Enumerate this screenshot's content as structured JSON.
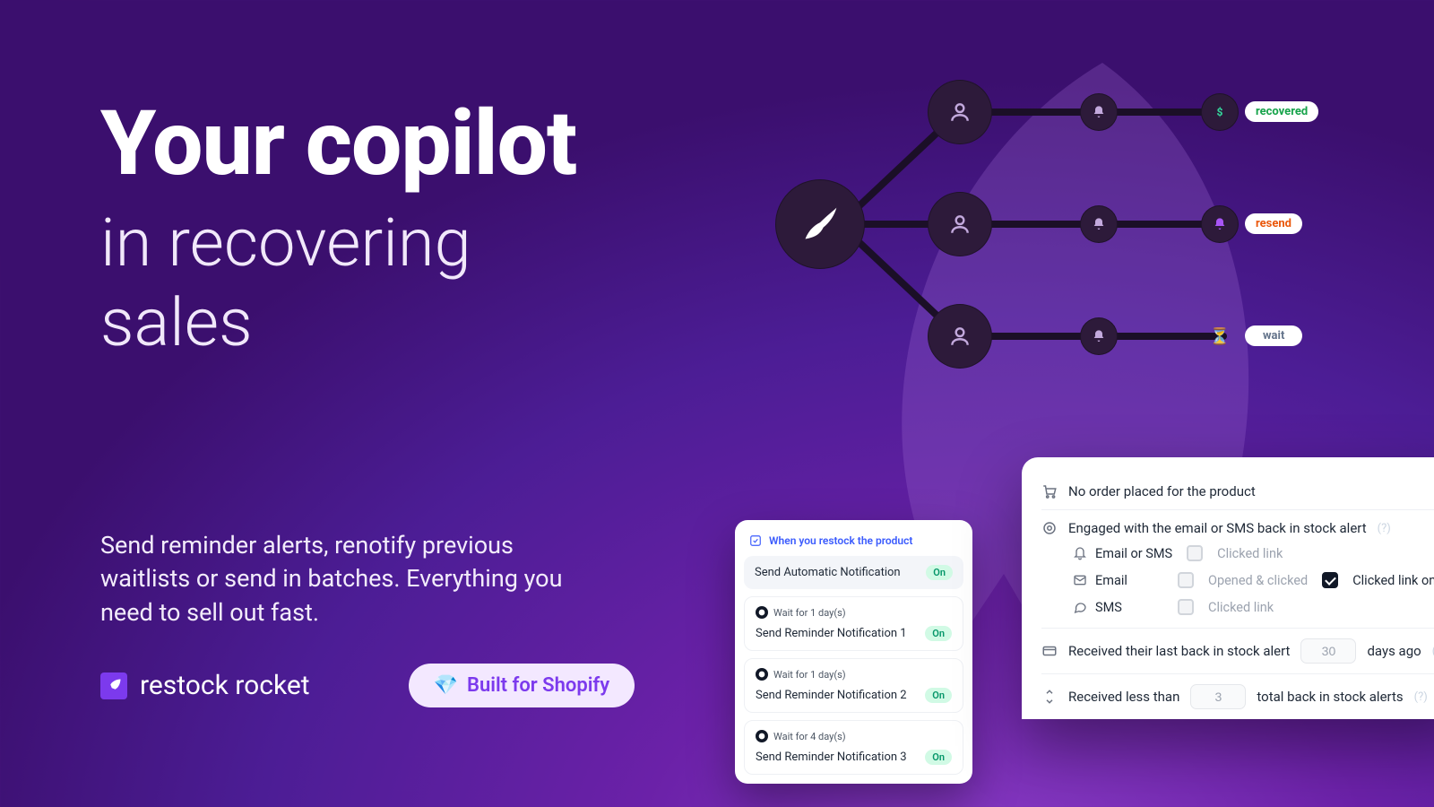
{
  "hero": {
    "headline_bold": "Your copilot",
    "headline_light": "in recovering sales",
    "subhead": "Send reminder alerts, renotify previous waitlists or send in batches. Everything you need to sell out fast.",
    "brand": "restock rocket",
    "built_badge": "Built for Shopify"
  },
  "diagram": {
    "pills": {
      "recovered": "recovered",
      "resend": "resend",
      "wait": "wait"
    }
  },
  "panel1": {
    "header": "When you restock the product",
    "auto_row": "Send Automatic Notification",
    "on": "On",
    "steps": [
      {
        "wait": "Wait for 1 day(s)",
        "label": "Send Reminder Notification 1"
      },
      {
        "wait": "Wait for 1 day(s)",
        "label": "Send Reminder Notification 2"
      },
      {
        "wait": "Wait for 4 day(s)",
        "label": "Send Reminder Notification 3"
      }
    ]
  },
  "panel2": {
    "row1": "No order placed for the product",
    "row2": "Engaged with the email or SMS back in stock alert",
    "channels": {
      "both": "Email or SMS",
      "both_opt": "Clicked link",
      "email": "Email",
      "email_opt": "Opened & clicked",
      "sms": "SMS",
      "sms_opt": "Clicked link",
      "checked_opt": "Clicked link only"
    },
    "row3_pre": "Received their last back in stock alert",
    "row3_val": "30",
    "row3_post": "days ago",
    "row4_pre": "Received less than",
    "row4_val": "3",
    "row4_post": "total back in stock alerts",
    "hint": "(?)"
  }
}
